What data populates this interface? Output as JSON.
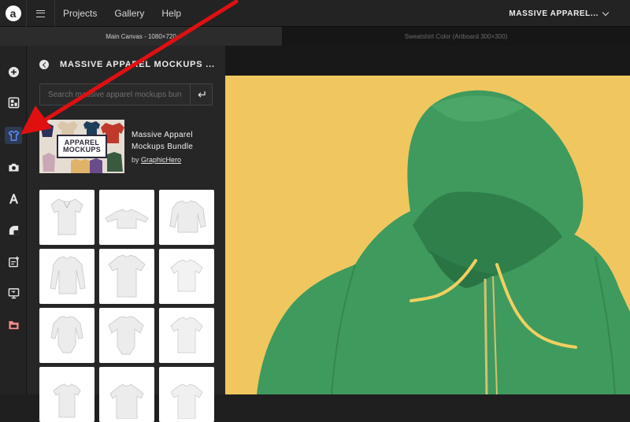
{
  "topbar": {
    "logo": "a",
    "nav": [
      "Projects",
      "Gallery",
      "Help"
    ],
    "project_name": "MASSIVE APPAREL..."
  },
  "tabs": {
    "active": "Main Canvas - 1080×720",
    "inactive": "Sweatshirt Color (Artboard 300×300)"
  },
  "sidebar": {
    "icons": [
      "add-icon",
      "templates-icon",
      "mockups-icon",
      "camera-icon",
      "text-icon",
      "shapes-icon",
      "add-page-icon",
      "screen-icon",
      "folder-icon"
    ],
    "active_index": 2
  },
  "panel": {
    "title": "MASSIVE APPAREL MOCKUPS ...",
    "search_placeholder": "Search massive apparel mockups bundle",
    "bundle": {
      "thumbnail_line1": "APPAREL",
      "thumbnail_line2": "MOCKUPS",
      "name": "Massive Apparel Mockups Bundle",
      "by_prefix": "by",
      "author": "GraphicHero"
    },
    "mockups": [
      "polo-shirt",
      "crewneck-sweatshirt",
      "sweatshirt",
      "long-sleeve-shirt",
      "t-shirt-flat",
      "t-shirt",
      "baby-bodysuit-long-sleeve",
      "baby-bodysuit",
      "kids-t-shirt",
      "tank-top",
      "hoodie",
      "t-shirt-plain"
    ]
  },
  "canvas": {
    "background_color": "#f0c75e",
    "garment_color": "#3f9a5e",
    "drawstring_color": "#f0d060"
  },
  "annotation": {
    "arrow_color": "#e01010"
  }
}
